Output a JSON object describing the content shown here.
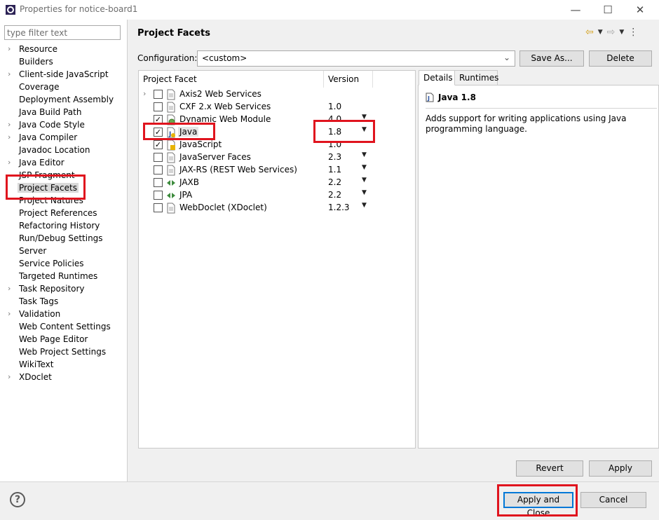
{
  "window": {
    "title": "Properties for notice-board1",
    "minimize_glyph": "—",
    "maximize_glyph": "☐",
    "close_glyph": "✕"
  },
  "filter": {
    "placeholder": "type filter text",
    "value": ""
  },
  "tree": [
    {
      "label": "Resource",
      "expandable": true
    },
    {
      "label": "Builders",
      "expandable": false
    },
    {
      "label": "Client-side JavaScript",
      "expandable": true
    },
    {
      "label": "Coverage",
      "expandable": false
    },
    {
      "label": "Deployment Assembly",
      "expandable": false
    },
    {
      "label": "Java Build Path",
      "expandable": false
    },
    {
      "label": "Java Code Style",
      "expandable": true
    },
    {
      "label": "Java Compiler",
      "expandable": true
    },
    {
      "label": "Javadoc Location",
      "expandable": false
    },
    {
      "label": "Java Editor",
      "expandable": true
    },
    {
      "label": "JSP Fragment",
      "expandable": false
    },
    {
      "label": "Project Facets",
      "expandable": false,
      "selected": true
    },
    {
      "label": "Project Natures",
      "expandable": false
    },
    {
      "label": "Project References",
      "expandable": false
    },
    {
      "label": "Refactoring History",
      "expandable": false
    },
    {
      "label": "Run/Debug Settings",
      "expandable": false
    },
    {
      "label": "Server",
      "expandable": false
    },
    {
      "label": "Service Policies",
      "expandable": false
    },
    {
      "label": "Targeted Runtimes",
      "expandable": false
    },
    {
      "label": "Task Repository",
      "expandable": true
    },
    {
      "label": "Task Tags",
      "expandable": false
    },
    {
      "label": "Validation",
      "expandable": true
    },
    {
      "label": "Web Content Settings",
      "expandable": false
    },
    {
      "label": "Web Page Editor",
      "expandable": false
    },
    {
      "label": "Web Project Settings",
      "expandable": false
    },
    {
      "label": "WikiText",
      "expandable": false
    },
    {
      "label": "XDoclet",
      "expandable": true
    }
  ],
  "page": {
    "title": "Project Facets",
    "config_label": "Configuration:",
    "config_value": "<custom>",
    "save_as": "Save As...",
    "delete": "Delete",
    "col_facet": "Project Facet",
    "col_version": "Version"
  },
  "facets": [
    {
      "name": "Axis2 Web Services",
      "version": "",
      "checked": false,
      "expandable": true,
      "dropdown": false,
      "icon": "doc-icon"
    },
    {
      "name": "CXF 2.x Web Services",
      "version": "1.0",
      "checked": false,
      "expandable": false,
      "dropdown": false,
      "icon": "doc-icon"
    },
    {
      "name": "Dynamic Web Module",
      "version": "4.0",
      "checked": true,
      "expandable": false,
      "dropdown": true,
      "icon": "web-module-icon"
    },
    {
      "name": "Java",
      "version": "1.8",
      "checked": true,
      "expandable": false,
      "dropdown": true,
      "selected": true,
      "icon": "java-icon"
    },
    {
      "name": "JavaScript",
      "version": "1.0",
      "checked": true,
      "expandable": false,
      "dropdown": false,
      "icon": "javascript-icon"
    },
    {
      "name": "JavaServer Faces",
      "version": "2.3",
      "checked": false,
      "expandable": false,
      "dropdown": true,
      "icon": "doc-icon"
    },
    {
      "name": "JAX-RS (REST Web Services)",
      "version": "1.1",
      "checked": false,
      "expandable": false,
      "dropdown": true,
      "icon": "doc-icon"
    },
    {
      "name": "JAXB",
      "version": "2.2",
      "checked": false,
      "expandable": false,
      "dropdown": true,
      "icon": "jaxb-icon"
    },
    {
      "name": "JPA",
      "version": "2.2",
      "checked": false,
      "expandable": false,
      "dropdown": true,
      "icon": "jpa-icon"
    },
    {
      "name": "WebDoclet (XDoclet)",
      "version": "1.2.3",
      "checked": false,
      "expandable": false,
      "dropdown": true,
      "icon": "doc-icon"
    }
  ],
  "details": {
    "tab_details": "Details",
    "tab_runtimes": "Runtimes",
    "heading": "Java 1.8",
    "description": "Adds support for writing applications using Java programming language."
  },
  "buttons": {
    "revert": "Revert",
    "apply": "Apply",
    "apply_and_close": "Apply and Close",
    "cancel": "Cancel",
    "help": "?"
  },
  "colors": {
    "highlight": "#e0141e",
    "arrow_nav": "#d4a017"
  }
}
